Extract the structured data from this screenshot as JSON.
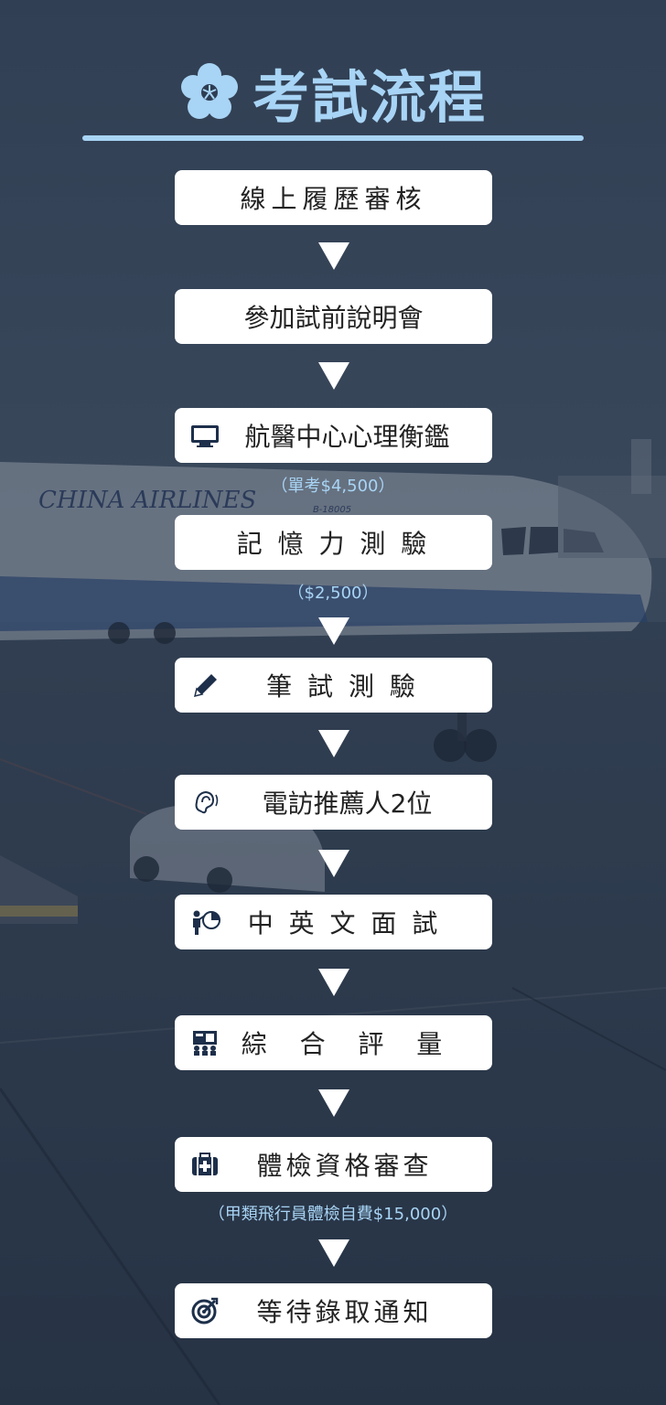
{
  "header": {
    "title": "考試流程",
    "flower_icon": "plum-blossom-icon",
    "accent": "#a8d4f5"
  },
  "background": {
    "description_icon": "airplane-on-tarmac-photo",
    "airline_text": "CHINA AIRLINES",
    "registration": "B-18005"
  },
  "steps": [
    {
      "label": "線上履歷審核",
      "icon": ""
    },
    {
      "label": "參加試前說明會",
      "icon": ""
    },
    {
      "label": "航醫中心心理衡鑑",
      "icon": "monitor-icon"
    },
    {
      "label": "記 憶 力 測 驗",
      "icon": ""
    },
    {
      "label": "筆 試 測 驗",
      "icon": "pencil-icon"
    },
    {
      "label": "電訪推薦人2位",
      "icon": "ear-icon"
    },
    {
      "label": "中 英 文 面 試",
      "icon": "presenter-icon"
    },
    {
      "label": "綜  合  評  量",
      "icon": "audience-icon"
    },
    {
      "label": "體檢資格審查",
      "icon": "medical-kit-icon"
    },
    {
      "label": "等待錄取通知",
      "icon": "target-icon"
    }
  ],
  "notes": {
    "psych_fee": "（單考$4,500）",
    "memory_fee": "（$2,500）",
    "medical_fee": "（甲類飛行員體檢自費$15,000）"
  }
}
